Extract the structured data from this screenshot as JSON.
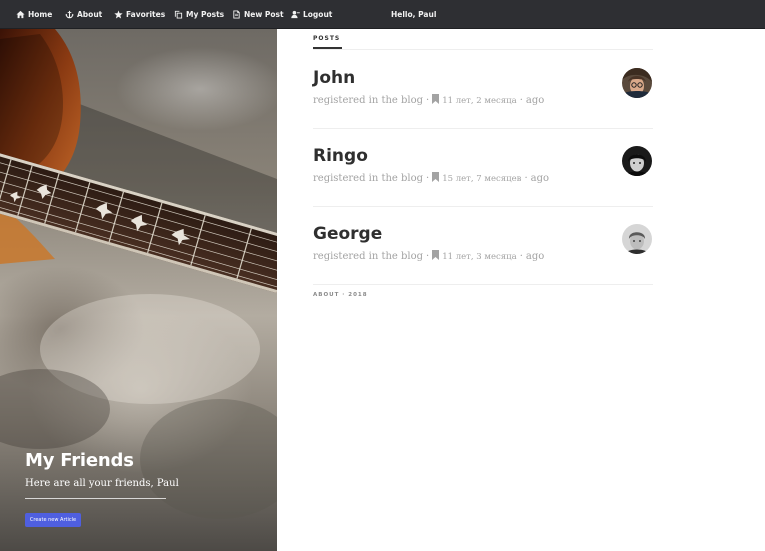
{
  "nav": {
    "items": [
      {
        "label": "Home",
        "icon": "home-icon"
      },
      {
        "label": "About",
        "icon": "anchor-icon"
      },
      {
        "label": "Favorites",
        "icon": "star-icon"
      },
      {
        "label": "My Posts",
        "icon": "copy-icon"
      },
      {
        "label": "New Post",
        "icon": "file-icon"
      },
      {
        "label": "Logout",
        "icon": "user-remove-icon"
      }
    ],
    "greeting": "Hello,  Paul"
  },
  "hero": {
    "title": "My Friends",
    "subtitle": "Here are all your friends,  Paul",
    "button_label": "Create new Article",
    "button_color": "#4f5fe0"
  },
  "main": {
    "section_label": "POSTS",
    "posts": [
      {
        "name": "John",
        "meta_prefix": "registered in the blog",
        "duration": "11 лет, 2 месяца",
        "suffix": "ago"
      },
      {
        "name": "Ringo",
        "meta_prefix": "registered in the blog",
        "duration": "15 лет, 7 месяцев",
        "suffix": "ago"
      },
      {
        "name": "George",
        "meta_prefix": "registered in the blog",
        "duration": "11 лет, 3 месяца",
        "suffix": "ago"
      }
    ],
    "footer": "ABOUT · 2018"
  },
  "colors": {
    "topbar": "#2e2f33",
    "accent": "#4f5fe0",
    "meta_text": "#a3a3a3"
  }
}
